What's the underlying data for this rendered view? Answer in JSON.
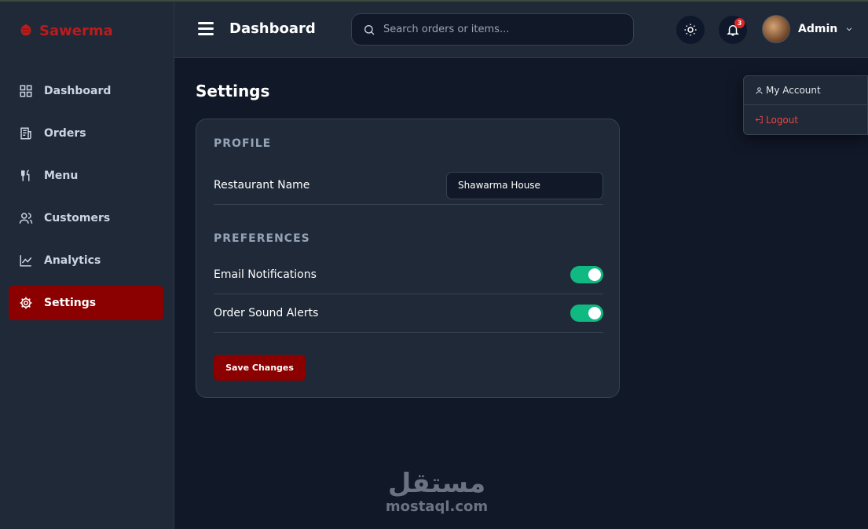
{
  "brand": {
    "name": "Sawerma",
    "color": "#b91c1c"
  },
  "sidebar": {
    "items": [
      {
        "label": "Dashboard",
        "icon": "grid-icon",
        "active": false
      },
      {
        "label": "Orders",
        "icon": "receipt-icon",
        "active": false
      },
      {
        "label": "Menu",
        "icon": "utensils-icon",
        "active": false
      },
      {
        "label": "Customers",
        "icon": "users-icon",
        "active": false
      },
      {
        "label": "Analytics",
        "icon": "line-chart-icon",
        "active": false
      },
      {
        "label": "Settings",
        "icon": "gear-icon",
        "active": true
      }
    ]
  },
  "header": {
    "title": "Dashboard",
    "search_placeholder": "Search orders or items...",
    "notification_count": "3",
    "user_name": "Admin"
  },
  "user_menu": {
    "items": [
      {
        "label": "My Account",
        "icon": "user-icon"
      },
      {
        "label": "Logout",
        "icon": "logout-icon"
      }
    ]
  },
  "main": {
    "page_title": "Settings",
    "profile": {
      "section_title": "PROFILE",
      "restaurant_name_label": "Restaurant Name",
      "restaurant_name_value": "Shawarma House"
    },
    "preferences": {
      "section_title": "PREFERENCES",
      "email_notifications_label": "Email Notifications",
      "email_notifications_on": true,
      "order_sound_label": "Order Sound Alerts",
      "order_sound_on": true
    },
    "save_label": "Save Changes"
  },
  "watermark": {
    "arabic": "مستقل",
    "latin": "mostaql.com"
  },
  "colors": {
    "accent": "#8b0000",
    "toggle_on": "#10b981",
    "background": "#111827",
    "panel": "#1f2937",
    "logout": "#ef4444"
  }
}
